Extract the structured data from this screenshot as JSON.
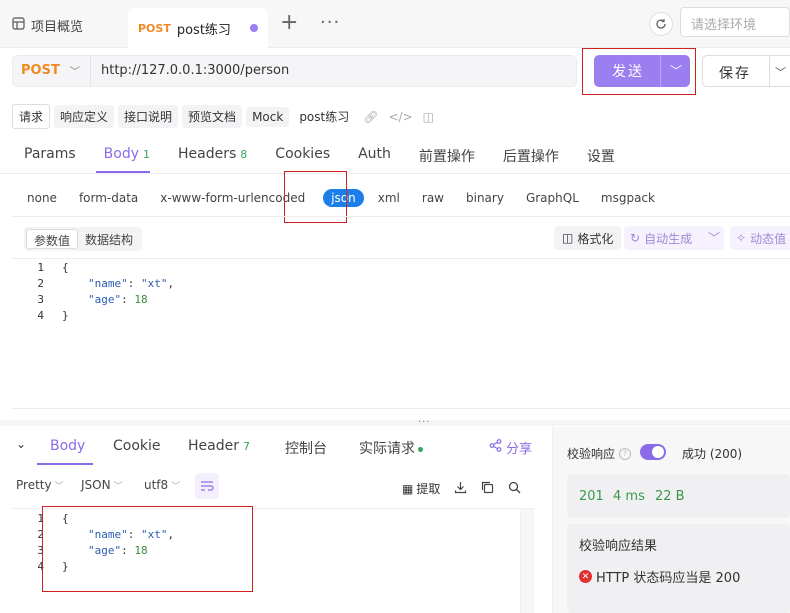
{
  "topbar": {
    "overview_label": "项目概览",
    "active_tab": {
      "method": "POST",
      "name": "post练习"
    },
    "plus": "+",
    "more": "···",
    "env_placeholder": "请选择环境"
  },
  "request": {
    "method": "POST",
    "url": "http://127.0.0.1:3000/person",
    "send_label": "发送",
    "save_label": "保存"
  },
  "doc_tabs": [
    "请求",
    "响应定义",
    "接口说明",
    "预览文档",
    "Mock",
    "post练习"
  ],
  "req_tabs": [
    {
      "label": "Params"
    },
    {
      "label": "Body",
      "count": "1"
    },
    {
      "label": "Headers",
      "count": "8"
    },
    {
      "label": "Cookies"
    },
    {
      "label": "Auth"
    },
    {
      "label": "前置操作"
    },
    {
      "label": "后置操作"
    },
    {
      "label": "设置"
    }
  ],
  "body_types": [
    "none",
    "form-data",
    "x-www-form-urlencoded",
    "json",
    "xml",
    "raw",
    "binary",
    "GraphQL",
    "msgpack"
  ],
  "params_toolbar": {
    "seg": [
      "参数值",
      "数据结构"
    ],
    "format": "格式化",
    "auto_gen": "自动生成",
    "dynamic": "动态值"
  },
  "request_code": {
    "line_numbers": [
      "1",
      "2",
      "3",
      "4"
    ],
    "open": "{",
    "name_key": "\"name\"",
    "name_val": "\"xt\"",
    "age_key": "\"age\"",
    "age_val": "18",
    "close": "}"
  },
  "splitter": "···",
  "response_tabs": [
    {
      "label": "Body"
    },
    {
      "label": "Cookie"
    },
    {
      "label": "Header",
      "count": "7"
    },
    {
      "label": "控制台"
    },
    {
      "label": "实际请求"
    }
  ],
  "share_label": "分享",
  "response_toolbar": {
    "view": "Pretty",
    "lang": "JSON",
    "encoding": "utf8",
    "extract": "提取"
  },
  "response_code": {
    "line_numbers": [
      "1",
      "2",
      "3",
      "4"
    ],
    "open": "{",
    "name_key": "\"name\"",
    "name_val": "\"xt\"",
    "age_key": "\"age\"",
    "age_val": "18",
    "close": "}"
  },
  "right_panel": {
    "validate_label": "校验响应",
    "status": "成功 (200)",
    "stats": {
      "code": "201",
      "time": "4 ms",
      "size": "22 B"
    },
    "result_title": "校验响应结果",
    "result_item": "HTTP 状态码应当是 200"
  },
  "colors": {
    "accent": "#8b6be8",
    "send": "#9b7ef0",
    "method": "#f08a24",
    "json_pill": "#1c7ee8",
    "success": "#3a9a4a",
    "error": "#e03030",
    "annotation": "#d02020"
  }
}
